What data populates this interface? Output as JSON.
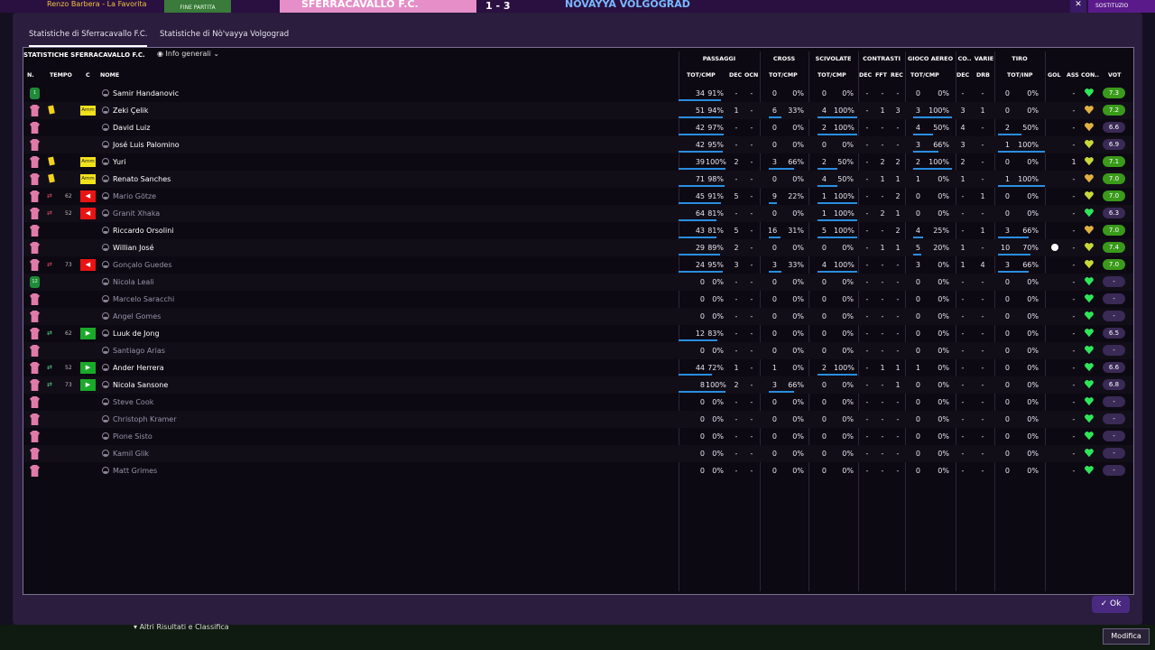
{
  "topbar": {
    "title": "Renzo Barbera - La Favorita",
    "pill_label": "FINE PARTITA",
    "home_team_short": "SFERRACAVALLO F.C.",
    "score": "1 - 3",
    "away_team_short": "NÒVAYYA VOLGOGRAD",
    "sost_label": "SOSTITUZIO"
  },
  "tabs": [
    {
      "label": "Statistiche di Sferracavallo F.C.",
      "active": true
    },
    {
      "label": "Statistiche di Nò'vayya Volgograd",
      "active": false
    }
  ],
  "panel": {
    "title": "STATISTICHE SFERRACAVALLO F.C.",
    "view_select": "Info generali"
  },
  "groups": [
    "PASSAGGI",
    "CROSS",
    "SCIVOLATE",
    "CONTRASTI",
    "GIOCO AEREO",
    "CO..",
    "VARIE",
    "TIRO"
  ],
  "columns": [
    "N.",
    "TEMPO",
    "C",
    "NOME",
    "TOT/CMP",
    "DEC",
    "OCN",
    "TOT/CMP",
    "TOT/CMP",
    "DEC",
    "FFT",
    "REC",
    "TOT/CMP",
    "DEC",
    "DRB",
    "TOT/INP",
    "GOL",
    "ASS",
    "CON..",
    "VOT"
  ],
  "players": [
    {
      "name": "Samir Handanovic",
      "gk": true,
      "num": "1",
      "card": "",
      "min": "",
      "sub": "",
      "pa": "34",
      "pp": "91%",
      "pd": "-",
      "po": "-",
      "ca": "0",
      "cp": "0%",
      "sa": "0",
      "sp": "0%",
      "cd": "-",
      "cf": "-",
      "cr": "-",
      "ga": "0",
      "gp": "0%",
      "co": "-",
      "dr": "-",
      "ta": "0",
      "tp": "0%",
      "gol": "",
      "ass": "-",
      "cond": "#2ee65a",
      "vot": "7.3",
      "vc": "#3a9a1a",
      "starter": true
    },
    {
      "name": "Zeki Çelik",
      "gk": false,
      "num": "",
      "card": "Amm",
      "min": "",
      "sub": "",
      "pa": "51",
      "pp": "94%",
      "pd": "1",
      "po": "-",
      "ca": "6",
      "cp": "33%",
      "sa": "4",
      "sp": "100%",
      "cd": "-",
      "cf": "1",
      "cr": "3",
      "ga": "3",
      "gp": "100%",
      "co": "3",
      "dr": "1",
      "ta": "0",
      "tp": "0%",
      "gol": "",
      "ass": "-",
      "cond": "#e0b040",
      "vot": "7.2",
      "vc": "#3a9a1a",
      "starter": true
    },
    {
      "name": "David Luiz",
      "gk": false,
      "num": "",
      "card": "",
      "min": "",
      "sub": "",
      "pa": "42",
      "pp": "97%",
      "pd": "-",
      "po": "-",
      "ca": "0",
      "cp": "0%",
      "sa": "2",
      "sp": "100%",
      "cd": "-",
      "cf": "-",
      "cr": "-",
      "ga": "4",
      "gp": "50%",
      "co": "4",
      "dr": "-",
      "ta": "2",
      "tp": "50%",
      "gol": "",
      "ass": "-",
      "cond": "#e0b040",
      "vot": "6.6",
      "vc": "#3a2a56",
      "starter": true
    },
    {
      "name": "José Luis Palomino",
      "gk": false,
      "num": "",
      "card": "",
      "min": "",
      "sub": "",
      "pa": "42",
      "pp": "95%",
      "pd": "-",
      "po": "-",
      "ca": "0",
      "cp": "0%",
      "sa": "0",
      "sp": "0%",
      "cd": "-",
      "cf": "-",
      "cr": "-",
      "ga": "3",
      "gp": "66%",
      "co": "3",
      "dr": "-",
      "ta": "1",
      "tp": "100%",
      "gol": "",
      "ass": "-",
      "cond": "#c8d83a",
      "vot": "6.9",
      "vc": "#3a2a56",
      "starter": true
    },
    {
      "name": "Yuri",
      "gk": false,
      "num": "",
      "card": "Amm",
      "min": "",
      "sub": "",
      "pa": "39",
      "pp": "100%",
      "pd": "2",
      "po": "-",
      "ca": "3",
      "cp": "66%",
      "sa": "2",
      "sp": "50%",
      "cd": "-",
      "cf": "2",
      "cr": "2",
      "ga": "2",
      "gp": "100%",
      "co": "2",
      "dr": "-",
      "ta": "0",
      "tp": "0%",
      "gol": "",
      "ass": "1",
      "cond": "#c8d83a",
      "vot": "7.1",
      "vc": "#3a9a1a",
      "starter": true
    },
    {
      "name": "Renato Sanches",
      "gk": false,
      "num": "",
      "card": "Amm",
      "min": "",
      "sub": "",
      "pa": "71",
      "pp": "98%",
      "pd": "-",
      "po": "-",
      "ca": "0",
      "cp": "0%",
      "sa": "4",
      "sp": "50%",
      "cd": "-",
      "cf": "1",
      "cr": "1",
      "ga": "1",
      "gp": "0%",
      "co": "1",
      "dr": "-",
      "ta": "1",
      "tp": "100%",
      "gol": "",
      "ass": "-",
      "cond": "#e0b040",
      "vot": "7.0",
      "vc": "#3a9a1a",
      "starter": true
    },
    {
      "name": "Mario Götze",
      "gk": false,
      "num": "",
      "card": "",
      "min": "62",
      "sub": "out",
      "pa": "45",
      "pp": "91%",
      "pd": "5",
      "po": "-",
      "ca": "9",
      "cp": "22%",
      "sa": "1",
      "sp": "100%",
      "cd": "-",
      "cf": "-",
      "cr": "2",
      "ga": "0",
      "gp": "0%",
      "co": "-",
      "dr": "1",
      "ta": "0",
      "tp": "0%",
      "gol": "",
      "ass": "-",
      "cond": "#c8d83a",
      "vot": "7.0",
      "vc": "#3a9a1a",
      "starter": true
    },
    {
      "name": "Granit Xhaka",
      "gk": false,
      "num": "",
      "card": "",
      "min": "52",
      "sub": "out",
      "pa": "64",
      "pp": "81%",
      "pd": "-",
      "po": "-",
      "ca": "0",
      "cp": "0%",
      "sa": "1",
      "sp": "100%",
      "cd": "-",
      "cf": "2",
      "cr": "1",
      "ga": "0",
      "gp": "0%",
      "co": "-",
      "dr": "-",
      "ta": "0",
      "tp": "0%",
      "gol": "",
      "ass": "-",
      "cond": "#2ee65a",
      "vot": "6.3",
      "vc": "#3a2a56",
      "starter": true
    },
    {
      "name": "Riccardo Orsolini",
      "gk": false,
      "num": "",
      "card": "",
      "min": "",
      "sub": "",
      "pa": "43",
      "pp": "81%",
      "pd": "5",
      "po": "-",
      "ca": "16",
      "cp": "31%",
      "sa": "5",
      "sp": "100%",
      "cd": "-",
      "cf": "-",
      "cr": "2",
      "ga": "4",
      "gp": "25%",
      "co": "-",
      "dr": "1",
      "ta": "3",
      "tp": "66%",
      "gol": "",
      "ass": "-",
      "cond": "#e0b040",
      "vot": "7.0",
      "vc": "#3a9a1a",
      "starter": true
    },
    {
      "name": "Willian José",
      "gk": false,
      "num": "",
      "card": "",
      "min": "",
      "sub": "",
      "pa": "29",
      "pp": "89%",
      "pd": "2",
      "po": "-",
      "ca": "0",
      "cp": "0%",
      "sa": "0",
      "sp": "0%",
      "cd": "-",
      "cf": "1",
      "cr": "1",
      "ga": "5",
      "gp": "20%",
      "co": "1",
      "dr": "-",
      "ta": "10",
      "tp": "70%",
      "gol": "ball",
      "ass": "-",
      "cond": "#c8d83a",
      "vot": "7.4",
      "vc": "#3a9a1a",
      "starter": true
    },
    {
      "name": "Gonçalo Guedes",
      "gk": false,
      "num": "",
      "card": "",
      "min": "73",
      "sub": "out",
      "pa": "24",
      "pp": "95%",
      "pd": "3",
      "po": "-",
      "ca": "3",
      "cp": "33%",
      "sa": "4",
      "sp": "100%",
      "cd": "-",
      "cf": "-",
      "cr": "-",
      "ga": "3",
      "gp": "0%",
      "co": "1",
      "dr": "4",
      "ta": "3",
      "tp": "66%",
      "gol": "",
      "ass": "-",
      "cond": "#c8d83a",
      "vot": "7.0",
      "vc": "#3a9a1a",
      "starter": true
    },
    {
      "name": "Nicola Leali",
      "gk": true,
      "num": "12",
      "card": "",
      "min": "",
      "sub": "",
      "pa": "0",
      "pp": "0%",
      "pd": "-",
      "po": "-",
      "ca": "0",
      "cp": "0%",
      "sa": "0",
      "sp": "0%",
      "cd": "-",
      "cf": "-",
      "cr": "-",
      "ga": "0",
      "gp": "0%",
      "co": "-",
      "dr": "-",
      "ta": "0",
      "tp": "0%",
      "gol": "",
      "ass": "-",
      "cond": "#2ee65a",
      "vot": "-",
      "vc": "#3a2a56",
      "starter": false
    },
    {
      "name": "Marcelo Saracchi",
      "gk": false,
      "num": "",
      "card": "",
      "min": "",
      "sub": "",
      "pa": "0",
      "pp": "0%",
      "pd": "-",
      "po": "-",
      "ca": "0",
      "cp": "0%",
      "sa": "0",
      "sp": "0%",
      "cd": "-",
      "cf": "-",
      "cr": "-",
      "ga": "0",
      "gp": "0%",
      "co": "-",
      "dr": "-",
      "ta": "0",
      "tp": "0%",
      "gol": "",
      "ass": "-",
      "cond": "#2ee65a",
      "vot": "-",
      "vc": "#3a2a56",
      "starter": false
    },
    {
      "name": "Angel Gomes",
      "gk": false,
      "num": "",
      "card": "",
      "min": "",
      "sub": "",
      "pa": "0",
      "pp": "0%",
      "pd": "-",
      "po": "-",
      "ca": "0",
      "cp": "0%",
      "sa": "0",
      "sp": "0%",
      "cd": "-",
      "cf": "-",
      "cr": "-",
      "ga": "0",
      "gp": "0%",
      "co": "-",
      "dr": "-",
      "ta": "0",
      "tp": "0%",
      "gol": "",
      "ass": "-",
      "cond": "#2ee65a",
      "vot": "-",
      "vc": "#3a2a56",
      "starter": false
    },
    {
      "name": "Luuk de Jong",
      "gk": false,
      "num": "",
      "card": "",
      "min": "62",
      "sub": "in",
      "pa": "12",
      "pp": "83%",
      "pd": "-",
      "po": "-",
      "ca": "0",
      "cp": "0%",
      "sa": "0",
      "sp": "0%",
      "cd": "-",
      "cf": "-",
      "cr": "-",
      "ga": "0",
      "gp": "0%",
      "co": "-",
      "dr": "-",
      "ta": "0",
      "tp": "0%",
      "gol": "",
      "ass": "-",
      "cond": "#2ee65a",
      "vot": "6.5",
      "vc": "#3a2a56",
      "starter": true
    },
    {
      "name": "Santiago Arias",
      "gk": false,
      "num": "",
      "card": "",
      "min": "",
      "sub": "",
      "pa": "0",
      "pp": "0%",
      "pd": "-",
      "po": "-",
      "ca": "0",
      "cp": "0%",
      "sa": "0",
      "sp": "0%",
      "cd": "-",
      "cf": "-",
      "cr": "-",
      "ga": "0",
      "gp": "0%",
      "co": "-",
      "dr": "-",
      "ta": "0",
      "tp": "0%",
      "gol": "",
      "ass": "-",
      "cond": "#2ee65a",
      "vot": "-",
      "vc": "#3a2a56",
      "starter": false
    },
    {
      "name": "Ander Herrera",
      "gk": false,
      "num": "",
      "card": "",
      "min": "52",
      "sub": "in",
      "pa": "44",
      "pp": "72%",
      "pd": "1",
      "po": "-",
      "ca": "1",
      "cp": "0%",
      "sa": "2",
      "sp": "100%",
      "cd": "-",
      "cf": "1",
      "cr": "1",
      "ga": "1",
      "gp": "0%",
      "co": "-",
      "dr": "-",
      "ta": "0",
      "tp": "0%",
      "gol": "",
      "ass": "-",
      "cond": "#2ee65a",
      "vot": "6.6",
      "vc": "#3a2a56",
      "starter": true
    },
    {
      "name": "Nicola Sansone",
      "gk": false,
      "num": "",
      "card": "",
      "min": "73",
      "sub": "in",
      "pa": "8",
      "pp": "100%",
      "pd": "2",
      "po": "-",
      "ca": "3",
      "cp": "66%",
      "sa": "0",
      "sp": "0%",
      "cd": "-",
      "cf": "-",
      "cr": "1",
      "ga": "0",
      "gp": "0%",
      "co": "-",
      "dr": "-",
      "ta": "0",
      "tp": "0%",
      "gol": "",
      "ass": "-",
      "cond": "#2ee65a",
      "vot": "6.8",
      "vc": "#3a2a56",
      "starter": true
    },
    {
      "name": "Steve Cook",
      "gk": false,
      "num": "",
      "card": "",
      "min": "",
      "sub": "",
      "pa": "0",
      "pp": "0%",
      "pd": "-",
      "po": "-",
      "ca": "0",
      "cp": "0%",
      "sa": "0",
      "sp": "0%",
      "cd": "-",
      "cf": "-",
      "cr": "-",
      "ga": "0",
      "gp": "0%",
      "co": "-",
      "dr": "-",
      "ta": "0",
      "tp": "0%",
      "gol": "",
      "ass": "-",
      "cond": "#2ee65a",
      "vot": "-",
      "vc": "#3a2a56",
      "starter": false
    },
    {
      "name": "Christoph Kramer",
      "gk": false,
      "num": "",
      "card": "",
      "min": "",
      "sub": "",
      "pa": "0",
      "pp": "0%",
      "pd": "-",
      "po": "-",
      "ca": "0",
      "cp": "0%",
      "sa": "0",
      "sp": "0%",
      "cd": "-",
      "cf": "-",
      "cr": "-",
      "ga": "0",
      "gp": "0%",
      "co": "-",
      "dr": "-",
      "ta": "0",
      "tp": "0%",
      "gol": "",
      "ass": "-",
      "cond": "#2ee65a",
      "vot": "-",
      "vc": "#3a2a56",
      "starter": false
    },
    {
      "name": "Pione Sisto",
      "gk": false,
      "num": "",
      "card": "",
      "min": "",
      "sub": "",
      "pa": "0",
      "pp": "0%",
      "pd": "-",
      "po": "-",
      "ca": "0",
      "cp": "0%",
      "sa": "0",
      "sp": "0%",
      "cd": "-",
      "cf": "-",
      "cr": "-",
      "ga": "0",
      "gp": "0%",
      "co": "-",
      "dr": "-",
      "ta": "0",
      "tp": "0%",
      "gol": "",
      "ass": "-",
      "cond": "#2ee65a",
      "vot": "-",
      "vc": "#3a2a56",
      "starter": false
    },
    {
      "name": "Kamil Glik",
      "gk": false,
      "num": "",
      "card": "",
      "min": "",
      "sub": "",
      "pa": "0",
      "pp": "0%",
      "pd": "-",
      "po": "-",
      "ca": "0",
      "cp": "0%",
      "sa": "0",
      "sp": "0%",
      "cd": "-",
      "cf": "-",
      "cr": "-",
      "ga": "0",
      "gp": "0%",
      "co": "-",
      "dr": "-",
      "ta": "0",
      "tp": "0%",
      "gol": "",
      "ass": "-",
      "cond": "#2ee65a",
      "vot": "-",
      "vc": "#3a2a56",
      "starter": false
    },
    {
      "name": "Matt Grimes",
      "gk": false,
      "num": "",
      "card": "",
      "min": "",
      "sub": "",
      "pa": "0",
      "pp": "0%",
      "pd": "-",
      "po": "-",
      "ca": "0",
      "cp": "0%",
      "sa": "0",
      "sp": "0%",
      "cd": "-",
      "cf": "-",
      "cr": "-",
      "ga": "0",
      "gp": "0%",
      "co": "-",
      "dr": "-",
      "ta": "0",
      "tp": "0%",
      "gol": "",
      "ass": "-",
      "cond": "#2ee65a",
      "vot": "-",
      "vc": "#3a2a56",
      "starter": false
    }
  ],
  "ok_label": "✓ Ok",
  "bottom": {
    "results_label": "Altri Risultati e Classifica",
    "modifica_label": "Modifica"
  }
}
